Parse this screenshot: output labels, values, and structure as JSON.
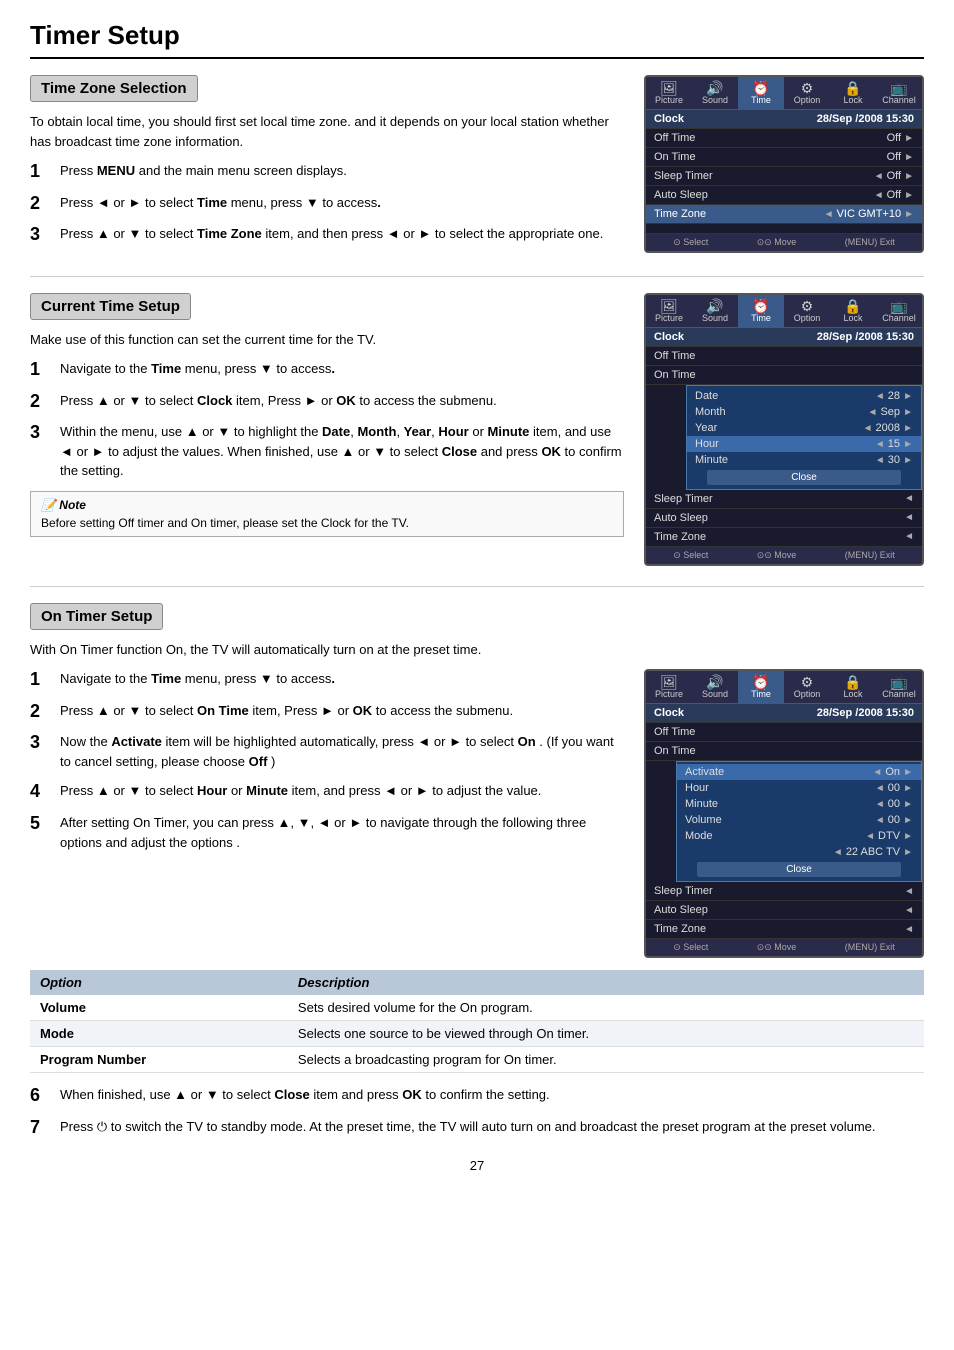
{
  "page": {
    "title": "Timer Setup",
    "page_number": "27"
  },
  "sections": {
    "time_zone": {
      "header": "Time Zone Selection",
      "intro": "To obtain local time, you should first set local time zone. and it depends on your local station whether has broadcast time zone information.",
      "steps": [
        {
          "num": "1",
          "text": "Press MENU and the main menu screen displays."
        },
        {
          "num": "2",
          "text": "Press ◄ or ► to select Time menu, press ▼ to access."
        },
        {
          "num": "3",
          "text": "Press ▲ or ▼ to select Time Zone item, and then press ◄ or ► to select the appropriate one."
        }
      ]
    },
    "current_time": {
      "header": "Current Time Setup",
      "intro": "Make use of this function can set the current time for the TV.",
      "steps": [
        {
          "num": "1",
          "text": "Navigate to the Time menu, press ▼ to access."
        },
        {
          "num": "2",
          "text": "Press ▲ or ▼ to select Clock item, Press ► or OK to access the submenu."
        },
        {
          "num": "3",
          "text": "Within the menu, use ▲ or ▼ to highlight the Date, Month, Year, Hour or Minute item, and use ◄ or ► to adjust the values. When finished, use ▲ or ▼ to select Close and press OK to confirm the setting."
        }
      ],
      "note": {
        "title": "Note",
        "text": "Before setting Off timer and On timer, please set the Clock for the TV."
      }
    },
    "on_timer": {
      "header": "On Timer Setup",
      "intro": "With On Timer function On, the TV will automatically turn on at the preset time.",
      "steps": [
        {
          "num": "1",
          "text": "Navigate to the Time menu, press ▼ to access."
        },
        {
          "num": "2",
          "text": "Press ▲ or ▼ to select On Time item, Press ► or OK to access the submenu."
        },
        {
          "num": "3",
          "text": "Now the Activate item will be highlighted automatically, press ◄ or ► to select On . (If you want to cancel setting, please choose Off )"
        },
        {
          "num": "4",
          "text": "Press ▲ or ▼ to select Hour or Minute item, and press ◄ or ► to adjust the value."
        },
        {
          "num": "5",
          "text": "After setting On Timer, you can press ▲, ▼, ◄ or ► to navigate through the following three options and adjust the options ."
        }
      ],
      "option_table": {
        "col1": "Option",
        "col2": "Description",
        "rows": [
          {
            "option": "Volume",
            "description": "Sets desired volume for the On program."
          },
          {
            "option": "Mode",
            "description": "Selects one source to be viewed through On timer."
          },
          {
            "option": "Program Number",
            "description": "Selects a broadcasting program for On timer."
          }
        ]
      },
      "steps_after": [
        {
          "num": "6",
          "text": "When finished, use ▲ or ▼ to select Close item and press OK to confirm the setting."
        },
        {
          "num": "7",
          "text": "Press ⏻ to switch the TV to standby mode. At the preset time, the TV will auto turn on and broadcast the preset program at the preset volume."
        }
      ]
    }
  },
  "menus": {
    "time_zone_menu": {
      "clock": "28/Sep /2008 15:30",
      "off_time": "Off",
      "on_time": "Off",
      "sleep_timer": "Off",
      "auto_sleep": "Off",
      "time_zone": "VIC GMT+10",
      "footer": [
        "Select",
        "Move",
        "Exit"
      ]
    },
    "current_time_menu": {
      "clock": "28/Sep /2008 15:30",
      "sub": {
        "date": "28",
        "month": "Sep",
        "year": "2008",
        "hour": "15",
        "minute": "30"
      },
      "footer": [
        "Select",
        "Move",
        "Exit"
      ]
    },
    "on_timer_menu": {
      "clock": "28/Sep /2008 15:30",
      "sub": {
        "activate": "On",
        "hour": "00",
        "minute": "00",
        "volume": "00",
        "mode": "DTV",
        "channel": "22 ABC TV"
      },
      "footer": [
        "Select",
        "Move",
        "Exit"
      ]
    }
  },
  "icons": {
    "picture": "🖼",
    "sound": "🔊",
    "time": "⏰",
    "option": "⚙",
    "lock": "🔒",
    "channel": "📺",
    "note": "📝",
    "power": "⏻"
  }
}
